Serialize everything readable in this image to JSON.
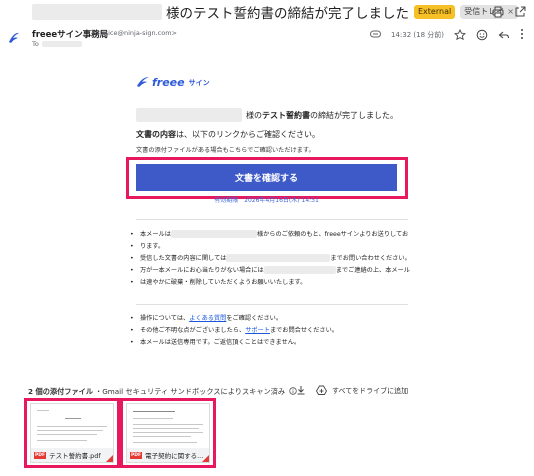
{
  "header": {
    "subject": "様のテスト誓約書の締結が完了しました",
    "label_external": "External",
    "label_inbox": "受信トレイ",
    "label_inbox_close": "×"
  },
  "sender": {
    "name": "freeeサイン事務局",
    "email": "<notice@ninja-sign.com>",
    "to": "To",
    "time": "14:32 (18 分前)"
  },
  "email_body": {
    "logo_text": "freee",
    "logo_sub": "サイン",
    "completion_suffix_1": "様の ",
    "completion_doc": "テスト誓約書",
    "completion_suffix_2": " の締結が完了しました。",
    "content_bold": "文書の内容",
    "content_rest": "は、以下のリンクからご確認ください。",
    "attachment_note": "文書の添付ファイルがある場合もこちらでご確認いただけます。",
    "cta_label": "文書を確認する",
    "expiry": "有効期限　2026年4月16日(木) 14:31",
    "bullet1_a": "本メールは",
    "bullet1_b": "様からのご依頼のもと、freeeサインよりお送りしてお",
    "bullet1_c": "ります。",
    "bullet2_a": "受信した文書の内容に関しては",
    "bullet2_b": "までお問い合わせください。",
    "bullet3_a": "万が一本メールにお心当たりがない場合には",
    "bullet3_b": "までご連絡の上、本メール",
    "bullet3_c": "は速やかに破棄・削除していただくようお願いいたします。",
    "bullet4_a": "操作については、",
    "bullet4_link": "よくある質問",
    "bullet4_b": "をご確認ください。",
    "bullet5_a": "その他ご不明な点がございましたら、",
    "bullet5_link": "サポート",
    "bullet5_b": "までお問合せください。",
    "bullet6": "本メールは送信専用です。ご返信頂くことはできません。"
  },
  "attachments": {
    "count_label": "2 個の添付ファイル",
    "scan_text": "・Gmail セキュリティ サンドボックスによりスキャン済み",
    "drive_label": "すべてをドライブに追加",
    "files": [
      {
        "name": "テスト誓約書.pdf",
        "type": "PDF"
      },
      {
        "name": "電子契約に関する...",
        "type": "PDF"
      }
    ]
  },
  "colors": {
    "cta": "#3e5ac8",
    "highlight": "#e8185f",
    "link": "#1a56db",
    "external_chip": "#f6c026"
  }
}
